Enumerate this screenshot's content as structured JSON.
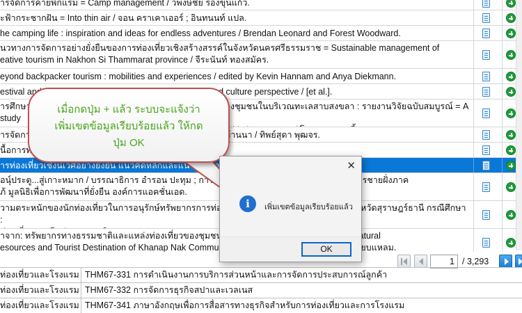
{
  "records": [
    {
      "title": "ารจัดการค่ายพักแรม = Camp management / วพงษ์ชัย รองขุนแก้ว.",
      "selected": false
    },
    {
      "title": "ะฟ้ากระชากฝัน = Into thin air / จอน คราเคาเออร์ ; อินทนนท์ แปล.",
      "selected": false
    },
    {
      "title": "he camping life : inspiration and ideas for endless adventures / Brendan Leonard and Forest Woodward.",
      "selected": false
    },
    {
      "title": "นวทางการจัดการอย่างยั่งยืนของการท่องเที่ยวเชิงสร้างสรรค์ในจังหวัดนครศรีธรรมราช = Sustainable management of\neative tourism in Nakhon Si Thammarat province / จีระนันท์ ทองสมัคร.",
      "selected": false
    },
    {
      "title": "eyond backpacker tourism : mobilities and experiences / edited by Kevin Hannam and Anya Diekmann.",
      "selected": false
    },
    {
      "title": "estival and events management : an international arts and culture perspective / [et al.].",
      "selected": false
    },
    {
      "title": "ารศึกษาศักยภาพด้านการท่องเที่ยวเชิงนิเวศและความพร้อมของชุมชนในบริเวณทะเลสาบสงขลา : รายงานวิจัยฉบับสมบูรณ์ = A study\nn potential of ecotourism and community readiness in Songkhla lagoon area / โดย สมชาย เลี้ยงพรพรรณ.",
      "selected": false
    },
    {
      "title": "ารจัดการท่องเที่ยวชุมชนอย่างมีส่วนร่วม : บทเรียนจากชุมชนบ้านนา / ทิพย์สุดา พุฒจร.",
      "selected": false
    },
    {
      "title": "นื้อการท่องเที่ยว",
      "selected": false
    },
    {
      "title": "ารท่องเที่ยวเชิงนิเวศอย่างยั่งยืน แนวคิดหลักและแนวทางการจัดการ / ",
      "selected": true
    },
    {
      "title": "อนุ์ประตู...สู่เกาะหมาก / บรรณาธิการ อำรอน ปะทุม ; การท่องเที่ยวเชิงนิเวศกับการจัดการทรัพยากรชายฝั่งภาค\nภ้ มูลนิธิเพื่อการพัฒนาที่ยั่งยืน องค์การแอคชั่นเอด.",
      "selected": false
    },
    {
      "title": "วามตระหนักของนักท่องเที่ยวในการอนุรักษ์ทรัพยากรการท่องเที่ยวทางทะเล ในอำเภอเกาะสมุย จังหวัดสุราษฎร์ธานี กรณีศึกษา :\nท่องเที่ยวชาวจีน / อรวรรณ จิตตาร.",
      "selected": false
    },
    {
      "title": "าจาก: ทรัพยากรทางธรรมชาติและแหล่งท่องเที่ยวของชุมชนขนาบนาก = The Rich Nipa Palm: Natural\nesources and Tourist Destination of Khanap Nak Community / บุญเลิศ จันทระเสนา / ธรณงค์ เฉียบแหลม.",
      "selected": false
    }
  ],
  "pager": {
    "current_page": "1",
    "total_pages": "/ 3,293"
  },
  "courses": [
    {
      "program": "ท่องเที่ยวและโรงแรม",
      "course": "THM67-331 การดำเนินงานการบริการส่วนหน้าและการจัดการประสบการณ์ลูกค้า"
    },
    {
      "program": "ท่องเที่ยวและโรงแรม",
      "course": "THM67-332 การจัดการธุรกิจสปาและเวลเนส"
    },
    {
      "program": "ท่องเที่ยวและโรงแรม",
      "course": "THM67-341 ภาษาอังกฤษเพื่อการสื่อสารทางธุรกิจสำหรับการท่องเที่ยวและการโรงแรม"
    }
  ],
  "callout": {
    "line1": "เมื่อกดปุ่ม + แล้ว ระบบจะแจ้งว่า",
    "line2": "เพิ่มเขตข้อมูลเรียบร้อยแล้ว ให้กด",
    "line3": "ปุ่ม OK"
  },
  "dialog": {
    "message": "เพิ่มเขตข้อมูลเรียบร้อยแล้ว",
    "ok_label": "OK",
    "close_symbol": "✕",
    "info_symbol": "i"
  },
  "colors": {
    "selected_row": "#0a78d7",
    "add_green": "#1f9d3a",
    "callout_border": "#c0504d",
    "callout_text": "#48a41b",
    "dialog_accent": "#0a64c8"
  },
  "icons": {
    "row_detail": "document-icon",
    "row_add": "plus-circle-icon",
    "dialog_info": "info-icon",
    "dialog_close": "close-icon"
  }
}
